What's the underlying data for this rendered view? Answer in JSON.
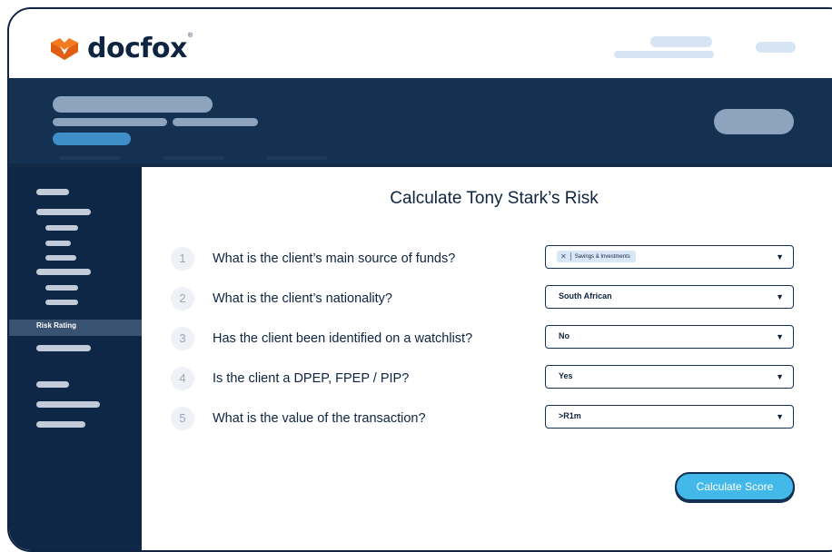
{
  "brand": {
    "name": "docfox",
    "registered_mark": "®",
    "colors": {
      "navy": "#0e2440",
      "hero": "#143152",
      "sidebar": "#0f2747",
      "accent": "#43b9ea",
      "orange": "#f47a20"
    }
  },
  "sidebar": {
    "active_item_label": "Risk Rating"
  },
  "main": {
    "title": "Calculate Tony Stark’s Risk",
    "questions": [
      {
        "number": "1",
        "text": "What is the client’s main source of funds?",
        "selected_tag": "Savings & Investments"
      },
      {
        "number": "2",
        "text": "What is the client’s nationality?",
        "selected_value": "South African"
      },
      {
        "number": "3",
        "text": "Has the client been identified on a watchlist?",
        "selected_value": "No"
      },
      {
        "number": "4",
        "text": "Is the client a DPEP, FPEP / PIP?",
        "selected_value": "Yes"
      },
      {
        "number": "5",
        "text": "What is the value of the transaction?",
        "selected_value": ">R1m"
      }
    ],
    "calculate_label": "Calculate Score"
  },
  "icons": {
    "dropdown": "caret-down-icon",
    "tag_remove": "close-icon",
    "logo": "fox-logo-icon"
  }
}
